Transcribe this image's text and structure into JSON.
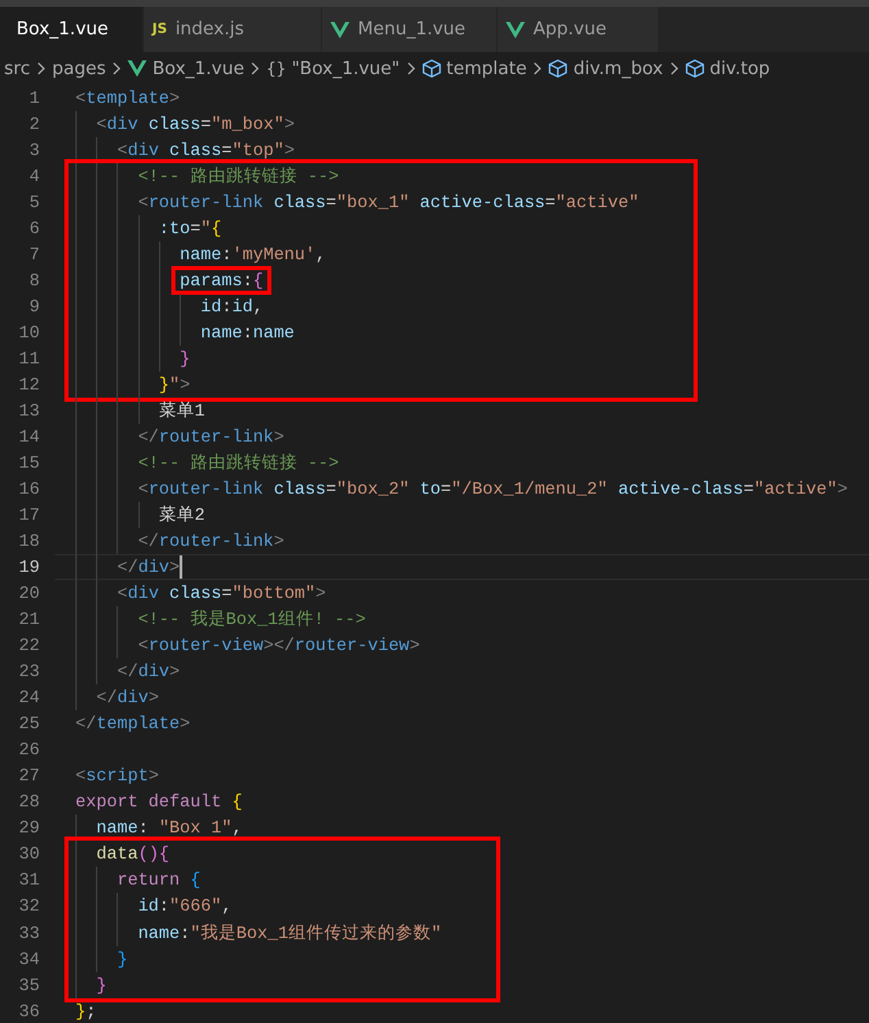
{
  "tabs": [
    {
      "label": "Box_1.vue",
      "kind": "vue",
      "selected": true
    },
    {
      "label": "index.js",
      "kind": "js",
      "icon_text": "JS",
      "selected": false
    },
    {
      "label": "Menu_1.vue",
      "kind": "vue",
      "selected": false
    },
    {
      "label": "App.vue",
      "kind": "vue",
      "selected": false
    }
  ],
  "breadcrumb": [
    {
      "label": "src",
      "kind": "folder"
    },
    {
      "label": "pages",
      "kind": "folder"
    },
    {
      "label": "Box_1.vue",
      "kind": "vue"
    },
    {
      "label": "\"Box_1.vue\"",
      "kind": "object",
      "icon_text": "{}"
    },
    {
      "label": "template",
      "kind": "element"
    },
    {
      "label": "div.m_box",
      "kind": "element"
    },
    {
      "label": "div.top",
      "kind": "element"
    }
  ],
  "code": [
    {
      "kind": "line",
      "number": "1",
      "current": false,
      "tokens": [
        {
          "kind": "bracket",
          "text": "<"
        },
        {
          "kind": "tag",
          "text": "template"
        },
        {
          "kind": "bracket",
          "text": ">"
        }
      ]
    },
    {
      "kind": "line",
      "number": "2",
      "current": false,
      "tokens": [
        {
          "kind": "bracket",
          "text": "  <"
        },
        {
          "kind": "tag",
          "text": "div"
        },
        {
          "kind": "attribute",
          "text": " class"
        },
        {
          "kind": "operator",
          "text": "="
        },
        {
          "kind": "string",
          "text": "\"m_box\""
        },
        {
          "kind": "bracket",
          "text": ">"
        }
      ]
    },
    {
      "kind": "line",
      "number": "3",
      "current": false,
      "tokens": [
        {
          "kind": "bracket",
          "text": "    <"
        },
        {
          "kind": "tag",
          "text": "div"
        },
        {
          "kind": "attribute",
          "text": " class"
        },
        {
          "kind": "operator",
          "text": "="
        },
        {
          "kind": "string",
          "text": "\"top\""
        },
        {
          "kind": "bracket",
          "text": ">"
        }
      ]
    },
    {
      "kind": "box",
      "lines": [
        {
          "kind": "line",
          "number": "4",
          "current": false,
          "tokens": [
            {
              "kind": "comment",
              "text": "      <!-- 路由跳转链接 -->"
            }
          ]
        },
        {
          "kind": "line",
          "number": "5",
          "current": false,
          "tokens": [
            {
              "kind": "bracket",
              "text": "      <"
            },
            {
              "kind": "tag",
              "text": "router-link"
            },
            {
              "kind": "attribute",
              "text": " class"
            },
            {
              "kind": "operator",
              "text": "="
            },
            {
              "kind": "string",
              "text": "\"box_1\""
            },
            {
              "kind": "attribute",
              "text": " active-class"
            },
            {
              "kind": "operator",
              "text": "="
            },
            {
              "kind": "string",
              "text": "\"active\""
            }
          ]
        },
        {
          "kind": "line",
          "number": "6",
          "current": false,
          "tokens": [
            {
              "kind": "attribute",
              "text": "        :to"
            },
            {
              "kind": "operator",
              "text": "="
            },
            {
              "kind": "string",
              "text": "\""
            },
            {
              "kind": "outerbrace",
              "text": "{"
            }
          ]
        },
        {
          "kind": "line",
          "number": "7",
          "current": false,
          "tokens": [
            {
              "kind": "attribute",
              "text": "          name"
            },
            {
              "kind": "operator",
              "text": ":"
            },
            {
              "kind": "string",
              "text": "'myMenu'"
            },
            {
              "kind": "operator",
              "text": ","
            }
          ]
        },
        {
          "kind": "tight-box",
          "lines": [
            {
              "kind": "line",
              "number": "8",
              "current": false,
              "tokens": [
                {
                  "kind": "attribute",
                  "text": "          params"
                },
                {
                  "kind": "operator",
                  "text": ":"
                },
                {
                  "kind": "innerbrace",
                  "text": "{"
                }
              ]
            }
          ]
        },
        {
          "kind": "line",
          "number": "9",
          "current": false,
          "tokens": [
            {
              "kind": "attribute",
              "text": "            id"
            },
            {
              "kind": "operator",
              "text": ":"
            },
            {
              "kind": "attribute",
              "text": "id"
            },
            {
              "kind": "operator",
              "text": ","
            }
          ]
        },
        {
          "kind": "line",
          "number": "10",
          "current": false,
          "tokens": [
            {
              "kind": "attribute",
              "text": "            name"
            },
            {
              "kind": "operator",
              "text": ":"
            },
            {
              "kind": "attribute",
              "text": "name"
            }
          ]
        },
        {
          "kind": "line",
          "number": "11",
          "current": false,
          "tokens": [
            {
              "kind": "innerbrace",
              "text": "          }"
            }
          ]
        },
        {
          "kind": "line",
          "number": "12",
          "current": false,
          "tokens": [
            {
              "kind": "outerbrace",
              "text": "        }"
            },
            {
              "kind": "string",
              "text": "\""
            },
            {
              "kind": "bracket",
              "text": ">"
            }
          ]
        }
      ]
    },
    {
      "kind": "line",
      "number": "13",
      "current": false,
      "tokens": [
        {
          "kind": "plain",
          "text": "        菜单1"
        }
      ]
    },
    {
      "kind": "line",
      "number": "14",
      "current": false,
      "tokens": [
        {
          "kind": "bracket",
          "text": "      </"
        },
        {
          "kind": "tag",
          "text": "router-link"
        },
        {
          "kind": "bracket",
          "text": ">"
        }
      ]
    },
    {
      "kind": "line",
      "number": "15",
      "current": false,
      "tokens": [
        {
          "kind": "comment",
          "text": "      <!-- 路由跳转链接 -->"
        }
      ]
    },
    {
      "kind": "line",
      "number": "16",
      "current": false,
      "tokens": [
        {
          "kind": "bracket",
          "text": "      <"
        },
        {
          "kind": "tag",
          "text": "router-link"
        },
        {
          "kind": "attribute",
          "text": " class"
        },
        {
          "kind": "operator",
          "text": "="
        },
        {
          "kind": "string",
          "text": "\"box_2\""
        },
        {
          "kind": "attribute",
          "text": " to"
        },
        {
          "kind": "operator",
          "text": "="
        },
        {
          "kind": "string",
          "text": "\"/Box_1/menu_2\""
        },
        {
          "kind": "attribute",
          "text": " active-class"
        },
        {
          "kind": "operator",
          "text": "="
        },
        {
          "kind": "string",
          "text": "\"active\""
        },
        {
          "kind": "bracket",
          "text": ">"
        }
      ]
    },
    {
      "kind": "line",
      "number": "17",
      "current": false,
      "tokens": [
        {
          "kind": "plain",
          "text": "        菜单2"
        }
      ]
    },
    {
      "kind": "line",
      "number": "18",
      "current": false,
      "tokens": [
        {
          "kind": "bracket",
          "text": "      </"
        },
        {
          "kind": "tag",
          "text": "router-link"
        },
        {
          "kind": "bracket",
          "text": ">"
        }
      ]
    },
    {
      "kind": "line",
      "number": "19",
      "current": true,
      "tokens": [
        {
          "kind": "bracket",
          "text": "    </"
        },
        {
          "kind": "tag",
          "text": "div"
        },
        {
          "kind": "bracket",
          "text": ">"
        }
      ]
    },
    {
      "kind": "line",
      "number": "20",
      "current": false,
      "tokens": [
        {
          "kind": "bracket",
          "text": "    <"
        },
        {
          "kind": "tag",
          "text": "div"
        },
        {
          "kind": "attribute",
          "text": " class"
        },
        {
          "kind": "operator",
          "text": "="
        },
        {
          "kind": "string",
          "text": "\"bottom\""
        },
        {
          "kind": "bracket",
          "text": ">"
        }
      ]
    },
    {
      "kind": "line",
      "number": "21",
      "current": false,
      "tokens": [
        {
          "kind": "comment",
          "text": "      <!-- 我是Box_1组件! -->"
        }
      ]
    },
    {
      "kind": "line",
      "number": "22",
      "current": false,
      "tokens": [
        {
          "kind": "bracket",
          "text": "      <"
        },
        {
          "kind": "tag",
          "text": "router-view"
        },
        {
          "kind": "bracket",
          "text": "></"
        },
        {
          "kind": "tag",
          "text": "router-view"
        },
        {
          "kind": "bracket",
          "text": ">"
        }
      ]
    },
    {
      "kind": "line",
      "number": "23",
      "current": false,
      "tokens": [
        {
          "kind": "bracket",
          "text": "    </"
        },
        {
          "kind": "tag",
          "text": "div"
        },
        {
          "kind": "bracket",
          "text": ">"
        }
      ]
    },
    {
      "kind": "line",
      "number": "24",
      "current": false,
      "tokens": [
        {
          "kind": "bracket",
          "text": "  </"
        },
        {
          "kind": "tag",
          "text": "div"
        },
        {
          "kind": "bracket",
          "text": ">"
        }
      ]
    },
    {
      "kind": "line",
      "number": "25",
      "current": false,
      "tokens": [
        {
          "kind": "bracket",
          "text": "</"
        },
        {
          "kind": "tag",
          "text": "template"
        },
        {
          "kind": "bracket",
          "text": ">"
        }
      ]
    },
    {
      "kind": "line",
      "number": "26",
      "current": false
    },
    {
      "kind": "line",
      "number": "27",
      "current": false,
      "tokens": [
        {
          "kind": "bracket",
          "text": "<"
        },
        {
          "kind": "tag",
          "text": "script"
        },
        {
          "kind": "bracket",
          "text": ">"
        }
      ]
    },
    {
      "kind": "line",
      "number": "28",
      "current": false,
      "tokens": [
        {
          "kind": "keyword",
          "text": "export default"
        },
        {
          "kind": "outerbrace",
          "text": " {"
        }
      ]
    },
    {
      "kind": "line",
      "number": "29",
      "current": false,
      "tokens": [
        {
          "kind": "attribute",
          "text": "  name"
        },
        {
          "kind": "operator",
          "text": ":"
        },
        {
          "kind": "string",
          "text": " \"Box 1\""
        },
        {
          "kind": "operator",
          "text": ","
        }
      ]
    },
    {
      "kind": "box",
      "lines": [
        {
          "kind": "line",
          "number": "30",
          "current": false,
          "tokens": [
            {
              "kind": "function",
              "text": "  data"
            },
            {
              "kind": "innerbrace",
              "text": "(){"
            }
          ]
        },
        {
          "kind": "line",
          "number": "31",
          "current": false,
          "tokens": [
            {
              "kind": "keyword",
              "text": "    return"
            },
            {
              "kind": "deepbrace",
              "text": " {"
            }
          ]
        },
        {
          "kind": "line",
          "number": "32",
          "current": false,
          "tokens": [
            {
              "kind": "attribute",
              "text": "      id"
            },
            {
              "kind": "operator",
              "text": ":"
            },
            {
              "kind": "string",
              "text": "\"666\""
            },
            {
              "kind": "operator",
              "text": ","
            }
          ]
        },
        {
          "kind": "line",
          "number": "33",
          "current": false,
          "tokens": [
            {
              "kind": "attribute",
              "text": "      name"
            },
            {
              "kind": "operator",
              "text": ":"
            },
            {
              "kind": "string",
              "text": "\"我是Box_1组件传过来的参数\""
            }
          ]
        },
        {
          "kind": "line",
          "number": "34",
          "current": false,
          "tokens": [
            {
              "kind": "deepbrace",
              "text": "    }"
            }
          ]
        },
        {
          "kind": "line",
          "number": "35",
          "current": false,
          "tokens": [
            {
              "kind": "innerbrace",
              "text": "  }"
            }
          ]
        }
      ]
    },
    {
      "kind": "line",
      "number": "36",
      "current": false,
      "tokens": [
        {
          "kind": "outerbrace",
          "text": "}"
        },
        {
          "kind": "operator",
          "text": ";"
        }
      ]
    }
  ]
}
